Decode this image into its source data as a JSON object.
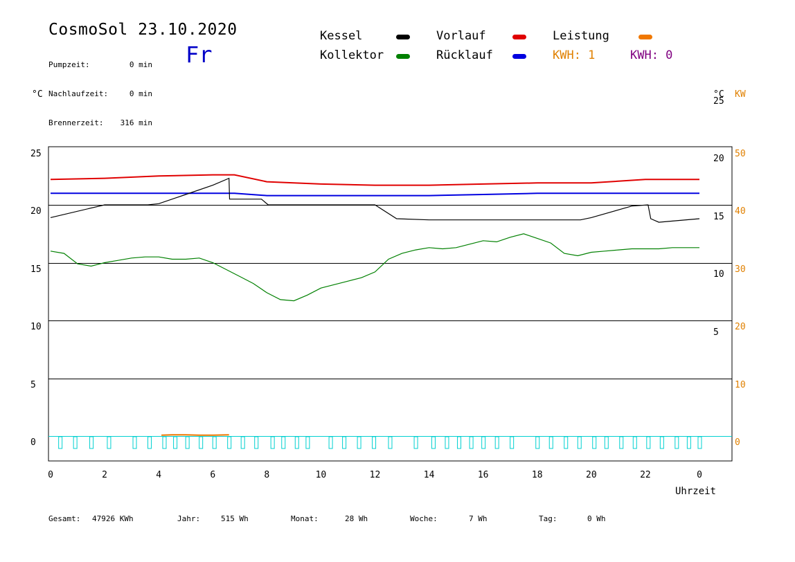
{
  "header": {
    "title": "CosmoSol 23.10.2020",
    "weekday": "Fr",
    "stats": [
      {
        "label": "Pumpzeit:",
        "value": "0 min"
      },
      {
        "label": "Nachlaufzeit:",
        "value": "0 min"
      },
      {
        "label": "Brennerzeit:",
        "value": "316 min"
      }
    ]
  },
  "legend": {
    "items": [
      {
        "label": "Kessel",
        "color": "#000000"
      },
      {
        "label": "Vorlauf",
        "color": "#e00000"
      },
      {
        "label": "Leistung",
        "color": "#f07800"
      },
      {
        "label": "Kollektor",
        "color": "#008000"
      },
      {
        "label": "Rücklauf",
        "color": "#0000e0"
      }
    ],
    "kwh_orange": "KWH: 1",
    "kwh_purple": "KWH: 0",
    "kwh_orange_color": "#e08000",
    "kwh_purple_color": "#800080"
  },
  "units": {
    "left": "°C",
    "right_c": "°C",
    "right_kw": "KW"
  },
  "footer": {
    "gesamt_label": "Gesamt:",
    "gesamt_value": "47926 KWh",
    "jahr_label": "Jahr:",
    "jahr_value": "515 Wh",
    "monat_label": "Monat:",
    "monat_value": "28 Wh",
    "woche_label": "Woche:",
    "woche_value": "7 Wh",
    "tag_label": "Tag:",
    "tag_value": "0 Wh"
  },
  "chart_data": {
    "type": "line",
    "title": "CosmoSol 23.10.2020",
    "xlabel": "Uhrzeit",
    "ylabel": "°C",
    "xlim": [
      0,
      24
    ],
    "ylim": [
      -2,
      27
    ],
    "x_ticks": [
      0,
      2,
      4,
      6,
      8,
      10,
      12,
      14,
      16,
      18,
      20,
      22,
      24
    ],
    "x_tick_labels": [
      "0",
      "2",
      "4",
      "6",
      "8",
      "10",
      "12",
      "14",
      "16",
      "18",
      "20",
      "22",
      "0"
    ],
    "y_ticks_left": [
      0,
      5,
      10,
      15,
      20,
      25
    ],
    "y_ticks_right_c": [
      5,
      10,
      15,
      20,
      25
    ],
    "y_ticks_right_kw": [
      0,
      10,
      20,
      30,
      40,
      50
    ],
    "grid": "horizontal",
    "series": [
      {
        "name": "Vorlauf",
        "color": "#e00000",
        "x": [
          0,
          2,
          4,
          6,
          6.8,
          8,
          10,
          12,
          14,
          16,
          18,
          20,
          22,
          24
        ],
        "y": [
          22.2,
          22.3,
          22.5,
          22.6,
          22.6,
          22.0,
          21.8,
          21.7,
          21.7,
          21.8,
          21.9,
          21.9,
          22.2,
          22.2
        ]
      },
      {
        "name": "Rücklauf",
        "color": "#0000e0",
        "x": [
          0,
          2,
          4,
          6,
          6.8,
          8,
          10,
          12,
          14,
          16,
          18,
          20,
          22,
          24
        ],
        "y": [
          21.0,
          21.0,
          21.0,
          21.0,
          21.0,
          20.8,
          20.8,
          20.8,
          20.8,
          20.9,
          21.0,
          21.0,
          21.0,
          21.0
        ]
      },
      {
        "name": "Kessel",
        "color": "#000000",
        "x": [
          0,
          2,
          3.6,
          4,
          5,
          6,
          6.6,
          6.62,
          7.8,
          8.05,
          9,
          10,
          12,
          12.8,
          14,
          16,
          18,
          19.6,
          20,
          21.5,
          22.1,
          22.2,
          22.5,
          23,
          24
        ],
        "y": [
          18.9,
          20.0,
          20.0,
          20.1,
          20.9,
          21.7,
          22.3,
          20.5,
          20.5,
          20.0,
          20.0,
          20.0,
          20.0,
          18.8,
          18.7,
          18.7,
          18.7,
          18.7,
          18.9,
          19.9,
          20.0,
          18.8,
          18.5,
          18.6,
          18.8
        ]
      },
      {
        "name": "Kollektor",
        "color": "#008000",
        "x": [
          0,
          0.5,
          1,
          1.5,
          2,
          2.5,
          3,
          3.5,
          4,
          4.5,
          5,
          5.5,
          6,
          6.5,
          7,
          7.5,
          8,
          8.5,
          9,
          9.5,
          10,
          10.5,
          11,
          11.5,
          12,
          12.5,
          13,
          13.5,
          14,
          14.5,
          15,
          15.5,
          16,
          16.5,
          17,
          17.5,
          18,
          18.5,
          19,
          19.5,
          20,
          20.5,
          21,
          21.5,
          22,
          22.5,
          23,
          23.5,
          24
        ],
        "y": [
          16.0,
          15.8,
          14.9,
          14.7,
          15.0,
          15.2,
          15.4,
          15.5,
          15.5,
          15.3,
          15.3,
          15.4,
          15.0,
          14.4,
          13.8,
          13.2,
          12.4,
          11.8,
          11.7,
          12.2,
          12.8,
          13.1,
          13.4,
          13.7,
          14.2,
          15.3,
          15.8,
          16.1,
          16.3,
          16.2,
          16.3,
          16.6,
          16.9,
          16.8,
          17.2,
          17.5,
          17.1,
          16.7,
          15.8,
          15.6,
          15.9,
          16.0,
          16.1,
          16.2,
          16.2,
          16.2,
          16.3,
          16.3,
          16.3
        ]
      },
      {
        "name": "Leistung",
        "color": "#f07800",
        "x": [
          4.1,
          4.5,
          5,
          5.5,
          6,
          6.6
        ],
        "y": [
          0.15,
          0.2,
          0.2,
          0.15,
          0.15,
          0.2
        ]
      }
    ],
    "pump_pulses_hours": [
      0.35,
      0.9,
      1.5,
      2.15,
      3.1,
      3.65,
      4.2,
      4.6,
      5.05,
      5.55,
      6.05,
      6.6,
      7.1,
      7.6,
      8.2,
      8.6,
      9.1,
      9.5,
      10.35,
      10.85,
      11.4,
      11.95,
      12.55,
      13.5,
      14.15,
      14.65,
      15.1,
      15.55,
      16.0,
      16.5,
      17.05,
      18.0,
      18.5,
      19.05,
      19.55,
      20.1,
      20.55,
      21.1,
      21.6,
      22.1,
      22.6,
      23.15,
      23.6,
      24.0
    ]
  }
}
